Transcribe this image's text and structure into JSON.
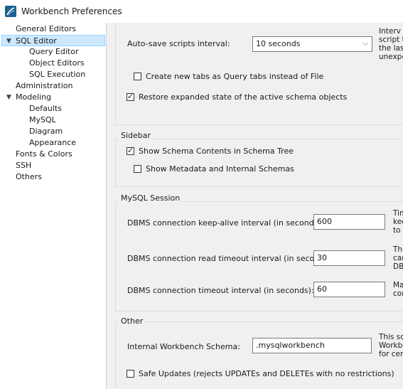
{
  "window": {
    "title": "Workbench Preferences",
    "icon": "mysql-workbench-icon"
  },
  "sidebar": {
    "items": [
      {
        "label": "General Editors"
      },
      {
        "label": "SQL Editor"
      },
      {
        "label": "Query Editor"
      },
      {
        "label": "Object Editors"
      },
      {
        "label": "SQL Execution"
      },
      {
        "label": "Administration"
      },
      {
        "label": "Modeling"
      },
      {
        "label": "Defaults"
      },
      {
        "label": "MySQL"
      },
      {
        "label": "Diagram"
      },
      {
        "label": "Appearance"
      },
      {
        "label": "Fonts & Colors"
      },
      {
        "label": "SSH"
      },
      {
        "label": "Others"
      }
    ]
  },
  "general": {
    "autosave_label": "Auto-save scripts interval:",
    "autosave_value": "10 seconds",
    "autosave_help": [
      "Interv",
      "script t",
      "the last",
      "unexpe"
    ],
    "new_tabs_label": "Create new tabs as Query tabs instead of File",
    "new_tabs_checked": false,
    "restore_label": "Restore expanded state of the active schema objects",
    "restore_checked": true
  },
  "sidebar_group": {
    "title": "Sidebar",
    "schema_contents_label": "Show Schema Contents in Schema Tree",
    "schema_contents_checked": true,
    "metadata_label": "Show Metadata and Internal Schemas",
    "metadata_checked": false
  },
  "mysql_session": {
    "title": "MySQL Session",
    "keepalive_label": "DBMS connection keep-alive interval (in seconds):",
    "keepalive_value": "600",
    "keepalive_help": [
      "Tim",
      "kee",
      "to r"
    ],
    "read_timeout_label": "DBMS connection read timeout interval (in seconds):",
    "read_timeout_value": "30",
    "read_timeout_help": [
      "The",
      "car",
      "DBI"
    ],
    "timeout_label": "DBMS connection timeout interval (in seconds):",
    "timeout_value": "60",
    "timeout_help": [
      "Ma",
      "cor"
    ]
  },
  "other": {
    "title": "Other",
    "schema_label": "Internal Workbench Schema:",
    "schema_value": ".mysqlworkbench",
    "schema_help": [
      "This sc",
      "Workbe",
      "for cert"
    ],
    "safe_updates_label": "Safe Updates (rejects UPDATEs and DELETEs with no restrictions)",
    "safe_updates_checked": false
  },
  "colors": {
    "selection": "#cce8ff",
    "selection_border": "#99d1ff",
    "panel": "#f0f0f0",
    "icon": "#1f5f8f"
  }
}
